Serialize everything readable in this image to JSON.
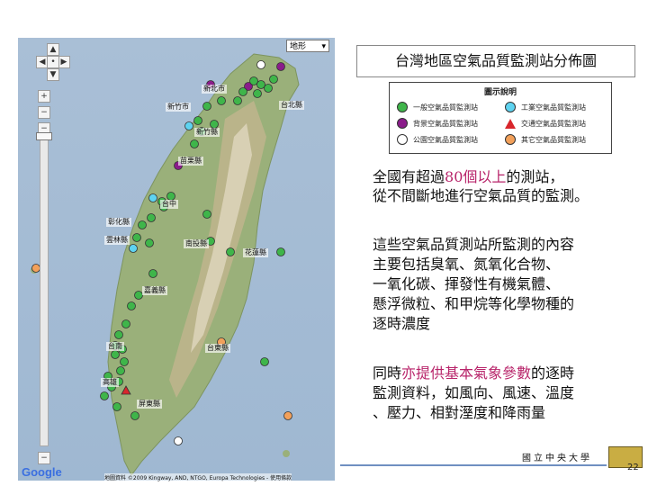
{
  "title": "台灣地區空氣品質監測站分佈圖",
  "legend": {
    "title": "圖示說明",
    "items": [
      {
        "label": "一般空氣品質監測站",
        "color": "#3fb54a",
        "shape": "circle"
      },
      {
        "label": "工業空氣品質監測站",
        "color": "#5ed3f0",
        "shape": "circle"
      },
      {
        "label": "背景空氣品質監測站",
        "color": "#8a1c8a",
        "shape": "circle"
      },
      {
        "label": "交通空氣品質監測站",
        "color": "#d8262c",
        "shape": "triangle"
      },
      {
        "label": "公園空氣品質監測站",
        "color": "#ffffff",
        "shape": "circle"
      },
      {
        "label": "其它空氣品質監測站",
        "color": "#f2a05a",
        "shape": "circle"
      }
    ]
  },
  "paragraph1": {
    "line1_pre": "全國有超過",
    "line1_hl": "80個以上",
    "line1_post": "的測站，",
    "line2": "從不間斷地進行空氣品質的監測。"
  },
  "paragraph2": [
    "這些空氣品質測站所監測的內容",
    "主要包括臭氧、氮氧化合物、",
    "一氧化碳、揮發性有機氣體、",
    "懸浮微粒、和甲烷等化學物種的",
    "逐時濃度"
  ],
  "paragraph3": {
    "line1_pre": "同時",
    "line1_hl": "亦提供基本氣象參數",
    "line1_post": "的逐時",
    "line2": "監測資料，如風向、風速、溫度",
    "line3": "、壓力、相對溼度和降雨量"
  },
  "map": {
    "type_label": "地形",
    "google_label": "Google",
    "credit": "地圖資料 ©2009 Kingway, AND, NTGO, Europa Technologies - 使用條款",
    "cities": [
      "新北市",
      "新竹市",
      "台北縣",
      "新竹縣",
      "苗栗縣",
      "台中",
      "彰化縣",
      "雲林縣",
      "南投縣",
      "花蓮縣",
      "嘉義縣",
      "台南",
      "台東縣",
      "高雄",
      "屏東縣"
    ]
  },
  "footer": {
    "school": "國立中央大學",
    "page": "22"
  },
  "colors": {
    "highlight": "#b8246a",
    "footer_line": "#6f8fc1"
  }
}
